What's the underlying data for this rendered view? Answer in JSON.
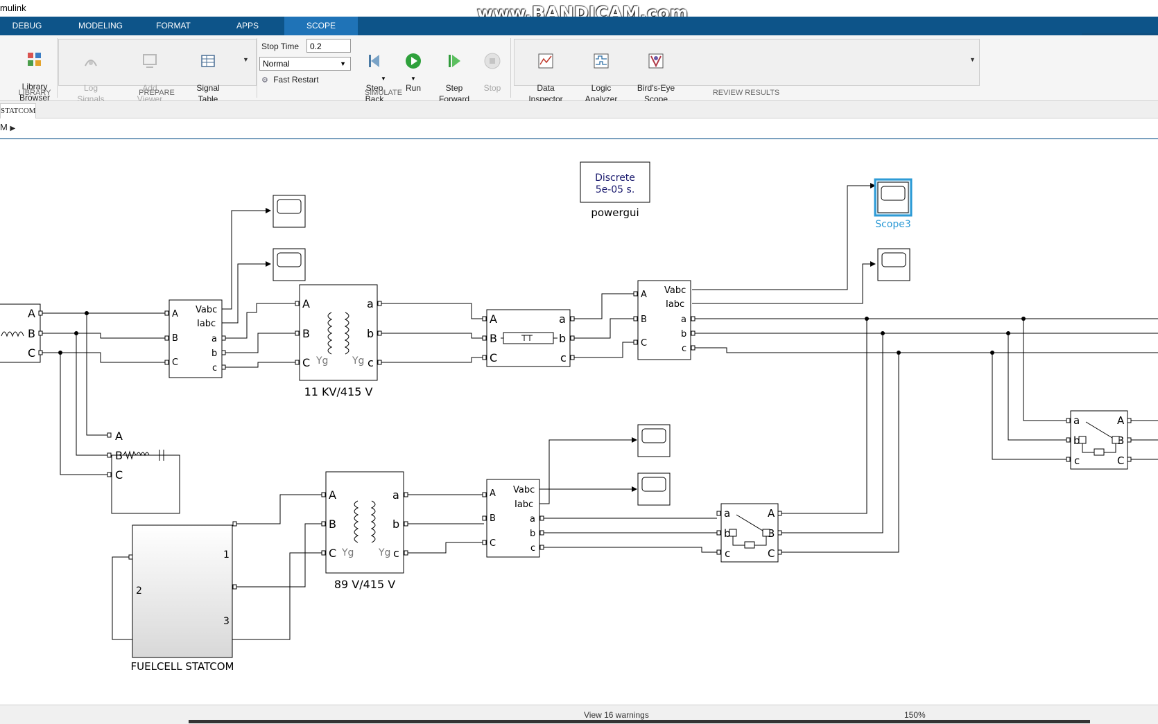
{
  "app": {
    "title": "mulink",
    "watermark": "www.BANDICAM.com"
  },
  "tabs": [
    {
      "label": "DEBUG"
    },
    {
      "label": "MODELING"
    },
    {
      "label": "FORMAT"
    },
    {
      "label": "APPS"
    },
    {
      "label": "SCOPE",
      "active": true
    }
  ],
  "ribbon": {
    "library": {
      "button": "Library\nBrowser",
      "group": "LIBRARY"
    },
    "prepare": {
      "group": "PREPARE",
      "log_signals": "Log\nSignals",
      "add_viewer": "Add\nViewer",
      "signal_table": "Signal\nTable"
    },
    "simulate": {
      "group": "SIMULATE",
      "stop_time_label": "Stop Time",
      "stop_time_value": "0.2",
      "mode_value": "Normal",
      "fast_restart": "Fast Restart",
      "step_back": "Step\nBack",
      "run": "Run",
      "step_forward": "Step\nForward",
      "stop": "Stop"
    },
    "review": {
      "group": "REVIEW RESULTS",
      "data_inspector": "Data\nInspector",
      "logic_analyzer": "Logic\nAnalyzer",
      "birds_eye": "Bird's-Eye\nScope"
    }
  },
  "doc_tab": "STATCOM",
  "breadcrumb": "M",
  "diagram": {
    "powergui_line1": "Discrete",
    "powergui_line2": "5e-05 s.",
    "powergui_name": "powergui",
    "scope3_name": "Scope3",
    "transformer1_name": "11 KV/415 V",
    "transformer2_name": "89 V/415 V",
    "fuelcell_name": "FUELCELL STATCOM",
    "port_labels": {
      "A": "A",
      "B": "B",
      "C": "C",
      "a": "a",
      "b": "b",
      "c": "c",
      "Vabc": "Vabc",
      "Iabc": "Iabc",
      "Yg": "Yg",
      "p1": "1",
      "p2": "2",
      "p3": "3"
    }
  },
  "status": {
    "warnings": "View 16 warnings",
    "zoom": "150%"
  },
  "colors": {
    "tabbar": "#0d5489",
    "tab_active": "#1f73b7",
    "selected": "#2e9bd6",
    "scope3_label": "#2e9bd6"
  }
}
